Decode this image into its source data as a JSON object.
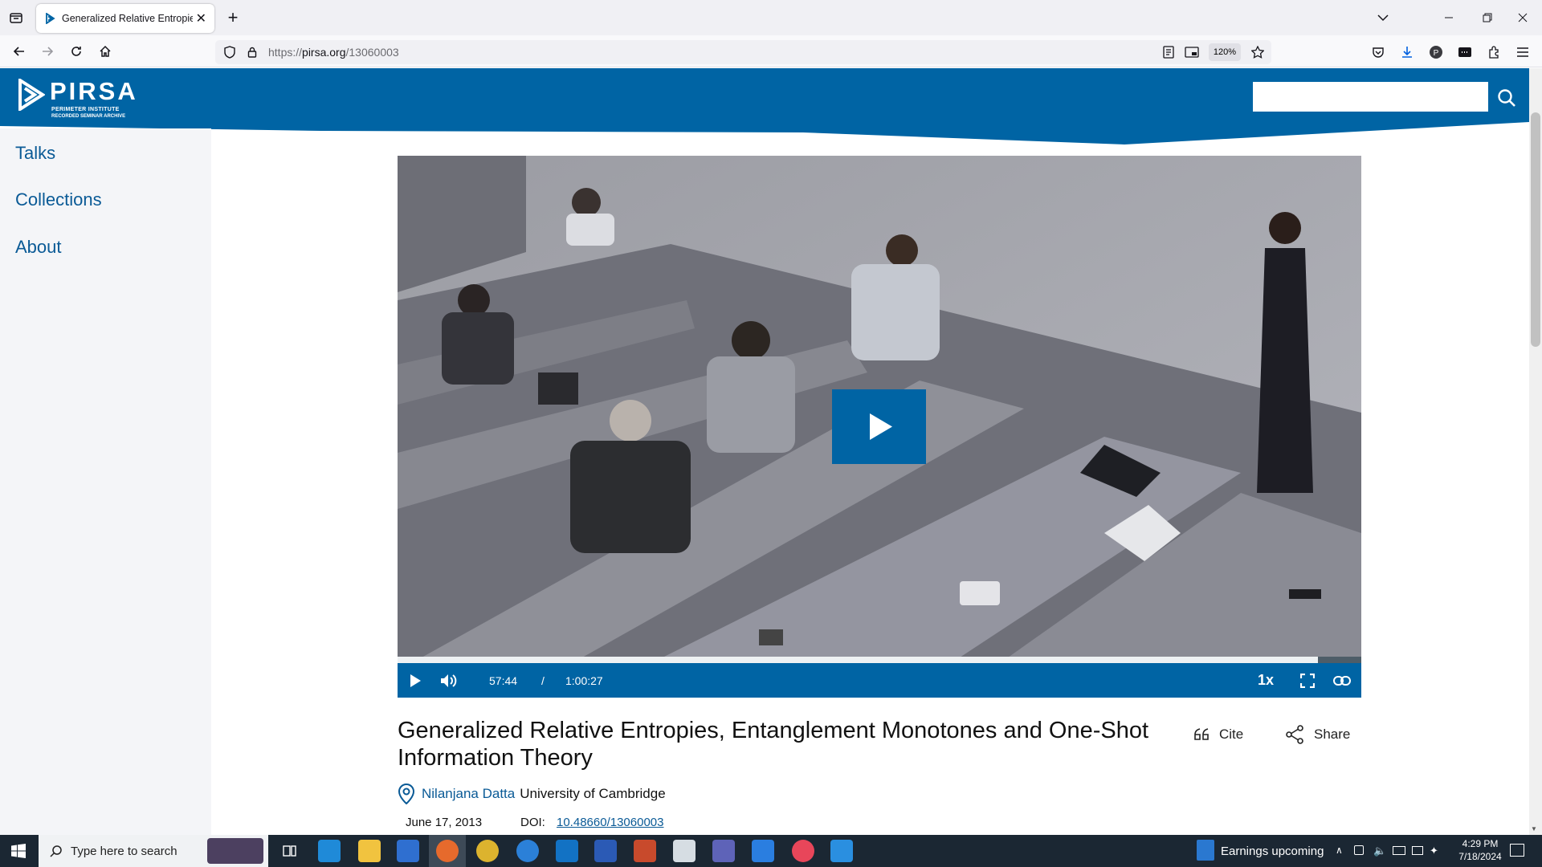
{
  "browser": {
    "tab_title": "Generalized Relative Entropies, ",
    "url_scheme": "https://",
    "url_host": "pirsa.org",
    "url_path": "/13060003",
    "zoom": "120%"
  },
  "site": {
    "logo_text": "PIRSA",
    "logo_subtitle_1": "PERIMETER INSTITUTE",
    "logo_subtitle_2": "RECORDED SEMINAR ARCHIVE",
    "search_placeholder": "",
    "colors": {
      "brand": "#0064a4",
      "link": "#0a5a96",
      "sidebar_bg": "#f4f5f8"
    }
  },
  "sidebar": {
    "items": [
      {
        "label": "Talks"
      },
      {
        "label": "Collections"
      },
      {
        "label": "About"
      }
    ]
  },
  "player": {
    "current_time": "57:44",
    "separator": "/",
    "duration": "1:00:27",
    "speed": "1x",
    "progress_fraction": 0.955
  },
  "talk": {
    "title": "Generalized Relative Entropies, Entanglement Monotones and One-Shot Information Theory",
    "cite_label": "Cite",
    "share_label": "Share",
    "speaker": "Nilanjana Datta",
    "affiliation": "University of Cambridge",
    "date": "June 17, 2013",
    "doi_label": "DOI:",
    "doi": "10.48660/13060003"
  },
  "taskbar": {
    "search_placeholder": "Type here to search",
    "news": "Earnings upcoming",
    "time": "4:29 PM",
    "date": "7/18/2024"
  }
}
